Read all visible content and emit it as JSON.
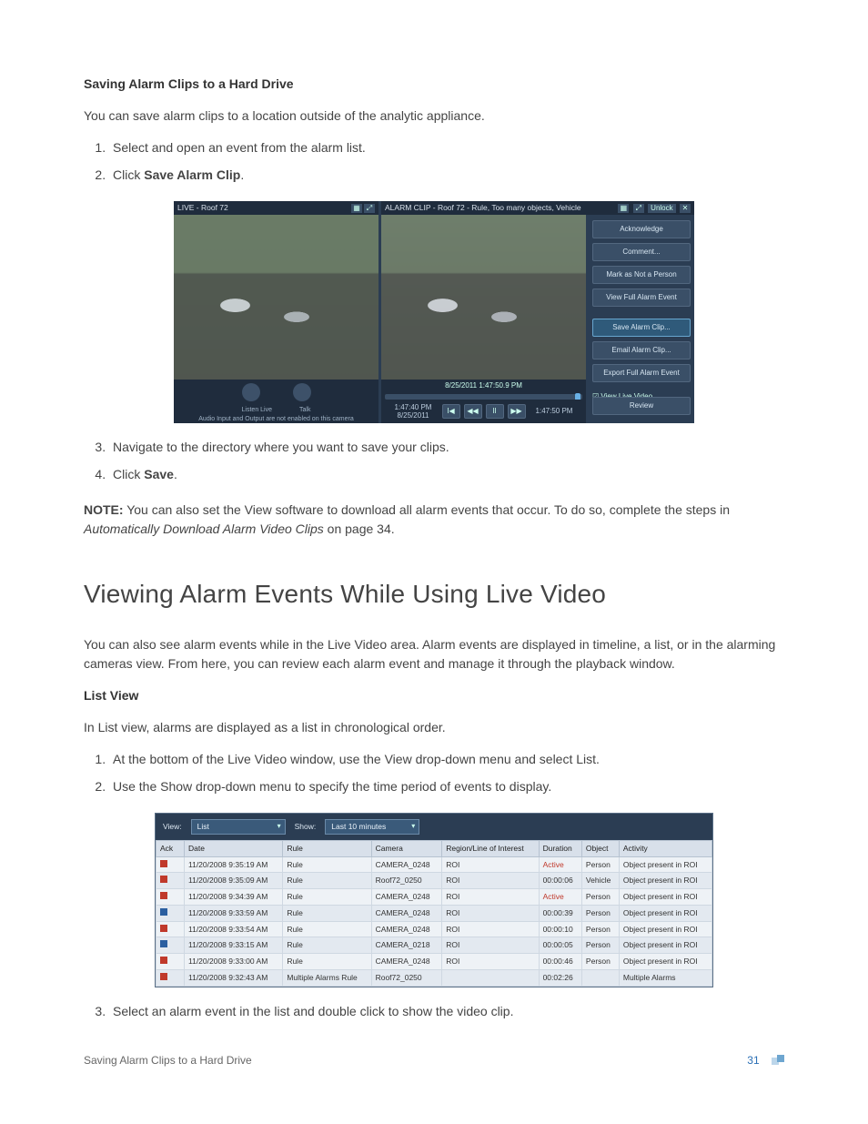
{
  "section1_title": "Saving Alarm Clips to a Hard Drive",
  "intro1": "You can save alarm clips to a location outside of the analytic appliance.",
  "steps1": {
    "s1": "Select and open an event from the alarm list.",
    "s2_a": "Click ",
    "s2_b": "Save Alarm Clip",
    "s2_c": ".",
    "s3": "Navigate to the directory where you want to save your clips.",
    "s4_a": "Click ",
    "s4_b": "Save",
    "s4_c": "."
  },
  "note_label": "NOTE:",
  "note_body_a": " You can also set the View software to download all alarm events that occur. To do so, complete the steps in ",
  "note_body_i": "Automatically Download Alarm Video Clips",
  "note_body_b": " on page 34.",
  "section2_title": "Viewing Alarm Events While Using Live Video",
  "intro2": "You can also see alarm events while in the Live Video area. Alarm events are displayed in timeline, a list, or in the alarming cameras view. From here, you can review each alarm event and manage it through the playback window.",
  "section3_title": "List View",
  "intro3": "In List view, alarms are displayed as a list in chronological order.",
  "steps2": {
    "s1": "At the bottom of the Live Video window, use the View drop-down menu and select List.",
    "s2": "Use the Show drop-down menu to specify the time period of events to display.",
    "s3": "Select an alarm event in the list and double click to show the video clip."
  },
  "fig1": {
    "left_title": "LIVE - Roof 72",
    "right_title": "ALARM CLIP - Roof 72 - Rule, Too many objects, Vehicle",
    "unlock": "Unlock",
    "close": "✕",
    "sidebar": {
      "b1": "Acknowledge",
      "b2": "Comment...",
      "b3": "Mark as Not a Person",
      "b4": "View Full Alarm Event",
      "b5": "Save Alarm Clip...",
      "b6": "Email Alarm Clip...",
      "b7": "Export Full Alarm Event",
      "chk": "☑ View Live Video",
      "review": "Review"
    },
    "timestamp": "8/25/2011 1:47:50.9 PM",
    "tL": "1:47:40 PM\n8/25/2011",
    "tR": "1:47:50 PM",
    "ctrl": {
      "first": "I◀",
      "rew": "◀◀",
      "pause": "II",
      "fwd": "▶▶"
    },
    "talk": {
      "listen": "Listen Live",
      "talk": "Talk",
      "note": "Audio Input and Output are not enabled on this camera"
    }
  },
  "fig2": {
    "view_label": "View:",
    "view_value": "List",
    "show_label": "Show:",
    "show_value": "Last 10 minutes",
    "headers": {
      "ack": "Ack",
      "date": "Date",
      "rule": "Rule",
      "camera": "Camera",
      "roi": "Region/Line of Interest",
      "dur": "Duration",
      "obj": "Object",
      "act": "Activity"
    },
    "rows": [
      {
        "c": "r",
        "date": "11/20/2008 9:35:19 AM",
        "rule": "Rule",
        "cam": "CAMERA_0248",
        "roi": "ROI",
        "dur": "Active",
        "dr": true,
        "obj": "Person",
        "act": "Object present in ROI"
      },
      {
        "c": "r",
        "date": "11/20/2008 9:35:09 AM",
        "rule": "Rule",
        "cam": "Roof72_0250",
        "roi": "ROI",
        "dur": "00:00:06",
        "obj": "Vehicle",
        "act": "Object present in ROI",
        "alt": true
      },
      {
        "c": "r",
        "date": "11/20/2008 9:34:39 AM",
        "rule": "Rule",
        "cam": "CAMERA_0248",
        "roi": "ROI",
        "dur": "Active",
        "dr": true,
        "obj": "Person",
        "act": "Object present in ROI"
      },
      {
        "c": "b",
        "date": "11/20/2008 9:33:59 AM",
        "rule": "Rule",
        "cam": "CAMERA_0248",
        "roi": "ROI",
        "dur": "00:00:39",
        "obj": "Person",
        "act": "Object present in ROI",
        "alt": true
      },
      {
        "c": "r",
        "date": "11/20/2008 9:33:54 AM",
        "rule": "Rule",
        "cam": "CAMERA_0248",
        "roi": "ROI",
        "dur": "00:00:10",
        "obj": "Person",
        "act": "Object present in ROI"
      },
      {
        "c": "b",
        "date": "11/20/2008 9:33:15 AM",
        "rule": "Rule",
        "cam": "CAMERA_0218",
        "roi": "ROI",
        "dur": "00:00:05",
        "obj": "Person",
        "act": "Object present in ROI",
        "alt": true
      },
      {
        "c": "r",
        "date": "11/20/2008 9:33:00 AM",
        "rule": "Rule",
        "cam": "CAMERA_0248",
        "roi": "ROI",
        "dur": "00:00:46",
        "obj": "Person",
        "act": "Object present in ROI"
      },
      {
        "c": "r",
        "date": "11/20/2008 9:32:43 AM",
        "rule": "Multiple Alarms Rule",
        "cam": "Roof72_0250",
        "roi": "",
        "dur": "00:02:26",
        "obj": "",
        "act": "Multiple Alarms",
        "alt": true
      }
    ]
  },
  "footer_title": "Saving Alarm Clips to a Hard Drive",
  "page_number": "31"
}
